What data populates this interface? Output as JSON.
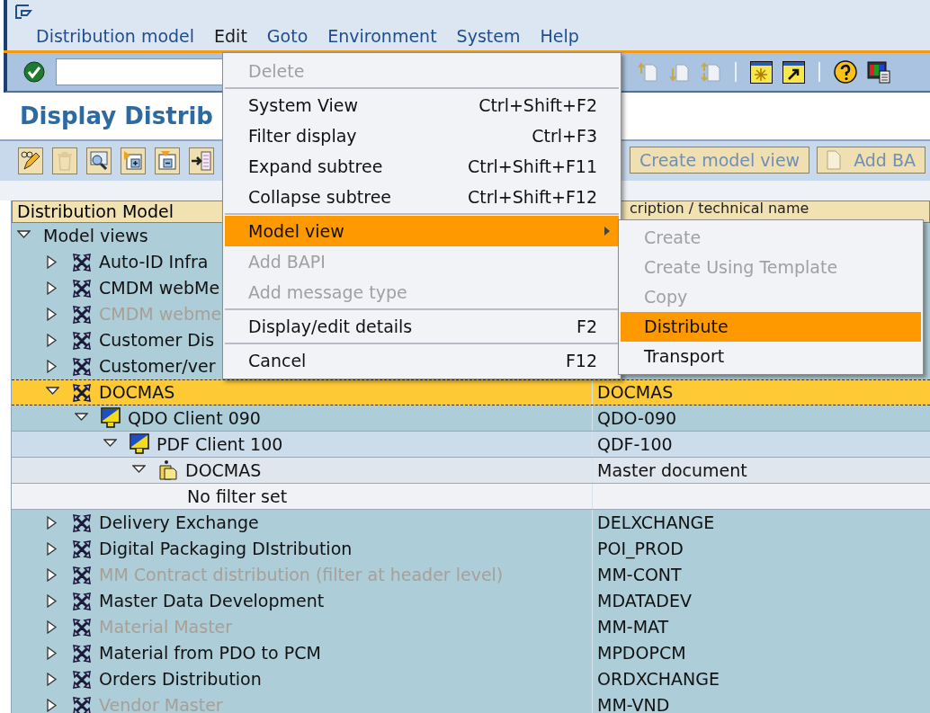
{
  "menu_bar": [
    {
      "label": "Distribution model",
      "selected": false
    },
    {
      "label": "Edit",
      "selected": true
    },
    {
      "label": "Goto",
      "selected": false
    },
    {
      "label": "Environment",
      "selected": false
    },
    {
      "label": "System",
      "selected": false
    },
    {
      "label": "Help",
      "selected": false
    }
  ],
  "title": "Display Distrib",
  "app_toolbar": {
    "buttons": [
      {
        "label": "Create model view",
        "disabled": true,
        "icon": false
      },
      {
        "label": "Add BA",
        "disabled": true,
        "icon": true
      }
    ]
  },
  "tree": {
    "columns": [
      "Distribution Model",
      "cription / technical name"
    ],
    "nodes": [
      {
        "kind": "folder",
        "label": "Model views",
        "expanded": true,
        "children": [
          {
            "kind": "model_view",
            "label": "Auto-ID Infra",
            "expanded": false,
            "disabled": false,
            "selected": false
          },
          {
            "kind": "model_view",
            "label": "CMDM webMe",
            "expanded": false,
            "disabled": false,
            "selected": false
          },
          {
            "kind": "model_view",
            "label": "CMDM webme",
            "expanded": false,
            "disabled": true,
            "selected": false
          },
          {
            "kind": "model_view",
            "label": "Customer Dis",
            "expanded": false,
            "disabled": false,
            "selected": false
          },
          {
            "kind": "model_view",
            "label": "Customer/ver",
            "expanded": false,
            "disabled": false,
            "selected": false
          },
          {
            "kind": "model_view",
            "label": "DOCMAS",
            "description": "DOCMAS",
            "expanded": true,
            "disabled": false,
            "selected": true,
            "children": [
              {
                "kind": "client",
                "label": "QDO Client 090",
                "description": "QDO-090",
                "expanded": true,
                "children": [
                  {
                    "kind": "client",
                    "label": "PDF Client 100",
                    "description": "QDF-100",
                    "expanded": true,
                    "children": [
                      {
                        "kind": "message_type",
                        "label": "DOCMAS",
                        "description": "Master document",
                        "expanded": true,
                        "children": [
                          {
                            "kind": "filter",
                            "label": "No filter set"
                          }
                        ]
                      }
                    ]
                  }
                ]
              }
            ]
          },
          {
            "kind": "model_view",
            "label": "Delivery Exchange",
            "description": "DELXCHANGE",
            "expanded": false,
            "disabled": false,
            "selected": false
          },
          {
            "kind": "model_view",
            "label": "Digital Packaging DIstribution",
            "description": "POI_PROD",
            "expanded": false,
            "disabled": false,
            "selected": false
          },
          {
            "kind": "model_view",
            "label": "MM Contract distribution (filter at header level)",
            "description": "MM-CONT",
            "expanded": false,
            "disabled": true,
            "selected": false
          },
          {
            "kind": "model_view",
            "label": "Master Data Development",
            "description": "MDATADEV",
            "expanded": false,
            "disabled": false,
            "selected": false
          },
          {
            "kind": "model_view",
            "label": "Material Master",
            "description": "MM-MAT",
            "expanded": false,
            "disabled": true,
            "selected": false
          },
          {
            "kind": "model_view",
            "label": "Material from PDO to PCM",
            "description": "MPDOPCM",
            "expanded": false,
            "disabled": false,
            "selected": false
          },
          {
            "kind": "model_view",
            "label": "Orders Distribution",
            "description": "ORDXCHANGE",
            "expanded": false,
            "disabled": false,
            "selected": false
          },
          {
            "kind": "model_view",
            "label": "Vendor Master",
            "description": "MM-VND",
            "expanded": false,
            "disabled": true,
            "selected": false
          }
        ]
      }
    ]
  },
  "edit_menu": {
    "items": [
      {
        "kind": "item",
        "label": "Delete",
        "disabled": true,
        "selected": false
      },
      {
        "kind": "separator"
      },
      {
        "kind": "item",
        "label": "System View",
        "shortcut": "Ctrl+Shift+F2",
        "disabled": false,
        "selected": false
      },
      {
        "kind": "item",
        "label": "Filter display",
        "shortcut": "Ctrl+F3",
        "disabled": false,
        "selected": false
      },
      {
        "kind": "item",
        "label": "Expand subtree",
        "shortcut": "Ctrl+Shift+F11",
        "disabled": false,
        "selected": false
      },
      {
        "kind": "item",
        "label": "Collapse subtree",
        "shortcut": "Ctrl+Shift+F12",
        "disabled": false,
        "selected": false
      },
      {
        "kind": "separator"
      },
      {
        "kind": "submenu",
        "label": "Model view",
        "disabled": false,
        "selected": true
      },
      {
        "kind": "item",
        "label": "Add BAPI",
        "disabled": true,
        "selected": false
      },
      {
        "kind": "item",
        "label": "Add message type",
        "disabled": true,
        "selected": false
      },
      {
        "kind": "separator"
      },
      {
        "kind": "item",
        "label": "Display/edit details",
        "shortcut": "F2",
        "disabled": false,
        "selected": false
      },
      {
        "kind": "separator"
      },
      {
        "kind": "item",
        "label": "Cancel",
        "shortcut": "F12",
        "disabled": false,
        "selected": false
      }
    ]
  },
  "model_view_submenu": {
    "items": [
      {
        "kind": "item",
        "label": "Create",
        "disabled": true,
        "selected": false
      },
      {
        "kind": "item",
        "label": "Create Using Template",
        "disabled": true,
        "selected": false
      },
      {
        "kind": "item",
        "label": "Copy",
        "disabled": true,
        "selected": false
      },
      {
        "kind": "item",
        "label": "Distribute",
        "disabled": false,
        "selected": true
      },
      {
        "kind": "item",
        "label": "Transport",
        "disabled": false,
        "selected": false
      }
    ]
  }
}
